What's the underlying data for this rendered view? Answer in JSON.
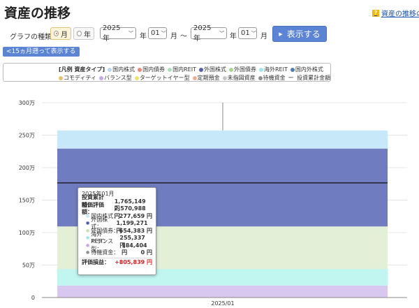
{
  "page": {
    "title": "資産の推移",
    "help_link": "資産の推移の"
  },
  "controls": {
    "graph_type_label": "グラフの種類:",
    "graph_types": [
      {
        "label": "月",
        "selected": true
      },
      {
        "label": "年",
        "selected": false
      }
    ],
    "from_year": "2025 年",
    "from_month": "01",
    "to_year": "2025 年",
    "to_month": "01",
    "year_unit": "年",
    "month_unit": "月",
    "tilde": "〜",
    "show_button": "表示する",
    "back_button": "<15ヵ月遡って表示する"
  },
  "legend": {
    "title": "[凡例 資産タイプ]",
    "items": [
      {
        "label": "国内株式",
        "color": "#b8d8f0"
      },
      {
        "label": "国内債券",
        "color": "#f08878"
      },
      {
        "label": "国内REIT",
        "color": "#b0e0b8"
      },
      {
        "label": "外国株式",
        "color": "#5060b0"
      },
      {
        "label": "外国債券",
        "color": "#a8d890"
      },
      {
        "label": "海外REIT",
        "color": "#a0e8e8"
      },
      {
        "label": "国内外株式",
        "color": "#5080b0"
      },
      {
        "label": "コモディティ",
        "color": "#e8c070"
      },
      {
        "label": "バランス型",
        "color": "#c8a8e8"
      },
      {
        "label": "ターゲットイヤー型",
        "color": "#f0e070"
      },
      {
        "label": "定期預金",
        "color": "#f0b090"
      },
      {
        "label": "未指図資産",
        "color": "#c8c8c8"
      },
      {
        "label": "待機資金",
        "color": "#909090"
      }
    ],
    "line_item": {
      "symbol": "ー",
      "label": "投資累計金額"
    }
  },
  "chart_data": {
    "type": "area",
    "x": [
      "2025/01"
    ],
    "y_ticks": [
      "0",
      "50万",
      "100万",
      "150万",
      "200万",
      "250万",
      "300万"
    ],
    "ylim": [
      0,
      3000000
    ],
    "series": [
      {
        "name": "バランス型",
        "values": [
          184404
        ],
        "color": "#d8c8f0"
      },
      {
        "name": "海外REIT",
        "values": [
          255337
        ],
        "color": "#c0f5f0"
      },
      {
        "name": "外国債券",
        "values": [
          654383
        ],
        "color": "#e4efd8"
      },
      {
        "name": "外国株式",
        "values": [
          1199271
        ],
        "color": "#6f7cbf"
      },
      {
        "name": "国内株式",
        "values": [
          277659
        ],
        "color": "#c6e8f8"
      },
      {
        "name": "待機資金",
        "values": [
          0
        ],
        "color": "#909090"
      }
    ],
    "line": {
      "name": "投資累計金額",
      "values": [
        1765149
      ],
      "color": "#111111"
    }
  },
  "tooltip": {
    "date": "2025年01月",
    "rows": [
      {
        "label": "投資累計額：",
        "value": "1,765,149 円",
        "bold": true
      },
      {
        "label": "時価評価額：",
        "value": "2,570,988 円",
        "bold": true
      },
      {
        "label": "国内株式：",
        "value": "277,659 円",
        "dot": "#c6e8f8"
      },
      {
        "label": "外国株式：",
        "value": "1,199,271 円",
        "dot": "#5060b0"
      },
      {
        "label": "外国債券：",
        "value": "654,383 円",
        "dot": "#c8e0b0"
      },
      {
        "label": "海外REIT：",
        "value": "255,337 円",
        "dot": "#a0e8e8"
      },
      {
        "label": "バランス型：",
        "value": "184,404 円",
        "dot": "#c8a8e8"
      },
      {
        "label": "待機資金：",
        "value": "0 円",
        "dot": "#909090"
      }
    ],
    "gain_label": "評価損益：",
    "gain_value": "+805,839 円"
  }
}
